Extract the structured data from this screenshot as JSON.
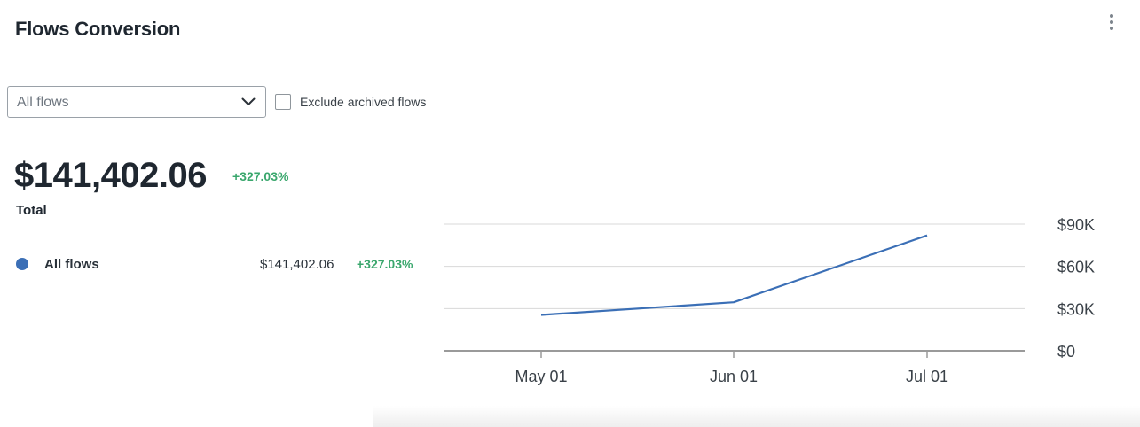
{
  "header": {
    "title": "Flows Conversion",
    "menu_icon": "kebab-menu-icon"
  },
  "filters": {
    "flow_select": {
      "value": "All flows",
      "icon": "chevron-down-icon"
    },
    "exclude_archived": {
      "label": "Exclude archived flows",
      "checked": false
    }
  },
  "summary": {
    "total_value": "$141,402.06",
    "change": "+327.03%",
    "label": "Total"
  },
  "legend": [
    {
      "name": "All flows",
      "value": "$141,402.06",
      "change": "+327.03%",
      "color": "#3b6fb6"
    }
  ],
  "colors": {
    "positive": "#3aa76d",
    "series": "#3b6fb6",
    "grid": "#d8d8d8",
    "axis": "#9a9a9a"
  },
  "chart_data": {
    "type": "line",
    "x": [
      "May 01",
      "Jun 01",
      "Jul 01"
    ],
    "series": [
      {
        "name": "All flows",
        "values": [
          25500,
          34500,
          82000
        ]
      }
    ],
    "ylim": [
      0,
      90000
    ],
    "y_ticks": [
      "$0",
      "$30K",
      "$60K",
      "$90K"
    ],
    "y_tick_values": [
      0,
      30000,
      60000,
      90000
    ],
    "y_axis_side": "right",
    "grid": true
  }
}
